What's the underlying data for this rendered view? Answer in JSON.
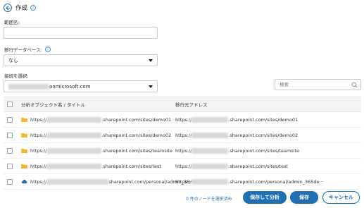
{
  "header": {
    "title": "作成"
  },
  "scope_name": {
    "label": "範囲名:",
    "value": ""
  },
  "migration_db": {
    "label": "移行データベース:",
    "value": "なし"
  },
  "connection": {
    "label": "接続を選択:",
    "value_suffix": "onmicrosoft.com"
  },
  "search": {
    "placeholder": "検索"
  },
  "table": {
    "columns": {
      "name": "分析オブジェクト名 / タイトル",
      "source": "移行元アドレス"
    },
    "rows": [
      {
        "icon": "folder-icon",
        "name_prefix": "https://",
        "name_suffix": ".sharepoint.com/sites/demo01",
        "src_prefix": "https://",
        "src_suffix": ".sharepoint.com/sites/demo01"
      },
      {
        "icon": "folder-icon",
        "name_prefix": "https://",
        "name_suffix": ".sharepoint.com/sites/demo02",
        "src_prefix": "https://",
        "src_suffix": ".sharepoint.com/sites/demo02"
      },
      {
        "icon": "folder-icon",
        "name_prefix": "https://",
        "name_suffix": ".sharepoint.com/sites/teamsite",
        "src_prefix": "https://",
        "src_suffix": ".sharepoint.com/sites/teamsite"
      },
      {
        "icon": "folder-icon",
        "name_prefix": "https://",
        "name_suffix": ".sharepoint.com/sites/test",
        "src_prefix": "https://",
        "src_suffix": ".sharepoint.com/sites/test"
      },
      {
        "icon": "cloud-icon",
        "name_prefix": "https://",
        "name_suffix": "sharepoint.com/personal/admin_36···",
        "src_prefix": "https://",
        "src_suffix": ".sharepoint.com/personal/admin_365de···"
      }
    ]
  },
  "footer": {
    "status": "0 件のノードを選択済み",
    "save_analyze": "保存して分析",
    "save": "保存",
    "cancel": "キャンセル"
  },
  "colors": {
    "accent": "#1f6fb5",
    "folder": "#f5b731",
    "cloud": "#2b6cb8"
  }
}
